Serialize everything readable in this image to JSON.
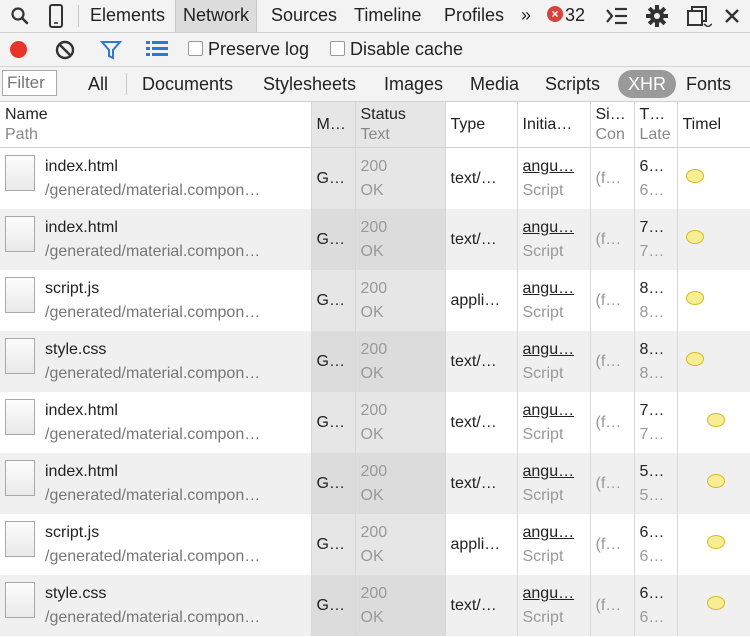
{
  "tabs": [
    "Elements",
    "Network",
    "Sources",
    "Timeline",
    "Profiles"
  ],
  "more_tabs": "»",
  "error_count": "32",
  "toolbar": {
    "preserve_log": "Preserve log",
    "disable_cache": "Disable cache"
  },
  "filter": {
    "placeholder": "Filter",
    "types": [
      "All",
      "Documents",
      "Stylesheets",
      "Images",
      "Media",
      "Scripts",
      "XHR",
      "Fonts"
    ],
    "active": "XHR"
  },
  "columns": {
    "name": "Name",
    "path": "Path",
    "method": "M…",
    "status": "Status",
    "text": "Text",
    "type": "Type",
    "initiator": "Initia…",
    "size": "Si…",
    "content": "Con",
    "time": "T…",
    "latency": "Late",
    "timeline": "Timel"
  },
  "rows": [
    {
      "name": "index.html",
      "path": "/generated/material.compon…",
      "method": "G…",
      "status": "200",
      "text": "OK",
      "type": "text/…",
      "initiator": "angu…",
      "init_type": "Script",
      "size": "(f…",
      "time": "6…",
      "latency": "6…",
      "dot": "left"
    },
    {
      "name": "index.html",
      "path": "/generated/material.compon…",
      "method": "G…",
      "status": "200",
      "text": "OK",
      "type": "text/…",
      "initiator": "angu…",
      "init_type": "Script",
      "size": "(f…",
      "time": "7…",
      "latency": "7…",
      "dot": "left"
    },
    {
      "name": "script.js",
      "path": "/generated/material.compon…",
      "method": "G…",
      "status": "200",
      "text": "OK",
      "type": "appli…",
      "initiator": "angu…",
      "init_type": "Script",
      "size": "(f…",
      "time": "8…",
      "latency": "8…",
      "dot": "left"
    },
    {
      "name": "style.css",
      "path": "/generated/material.compon…",
      "method": "G…",
      "status": "200",
      "text": "OK",
      "type": "text/…",
      "initiator": "angu…",
      "init_type": "Script",
      "size": "(f…",
      "time": "8…",
      "latency": "8…",
      "dot": "left"
    },
    {
      "name": "index.html",
      "path": "/generated/material.compon…",
      "method": "G…",
      "status": "200",
      "text": "OK",
      "type": "text/…",
      "initiator": "angu…",
      "init_type": "Script",
      "size": "(f…",
      "time": "7…",
      "latency": "7…",
      "dot": "right"
    },
    {
      "name": "index.html",
      "path": "/generated/material.compon…",
      "method": "G…",
      "status": "200",
      "text": "OK",
      "type": "text/…",
      "initiator": "angu…",
      "init_type": "Script",
      "size": "(f…",
      "time": "5…",
      "latency": "5…",
      "dot": "right"
    },
    {
      "name": "script.js",
      "path": "/generated/material.compon…",
      "method": "G…",
      "status": "200",
      "text": "OK",
      "type": "appli…",
      "initiator": "angu…",
      "init_type": "Script",
      "size": "(f…",
      "time": "6…",
      "latency": "6…",
      "dot": "right"
    },
    {
      "name": "style.css",
      "path": "/generated/material.compon…",
      "method": "G…",
      "status": "200",
      "text": "OK",
      "type": "text/…",
      "initiator": "angu…",
      "init_type": "Script",
      "size": "(f…",
      "time": "6…",
      "latency": "6…",
      "dot": "right"
    }
  ]
}
